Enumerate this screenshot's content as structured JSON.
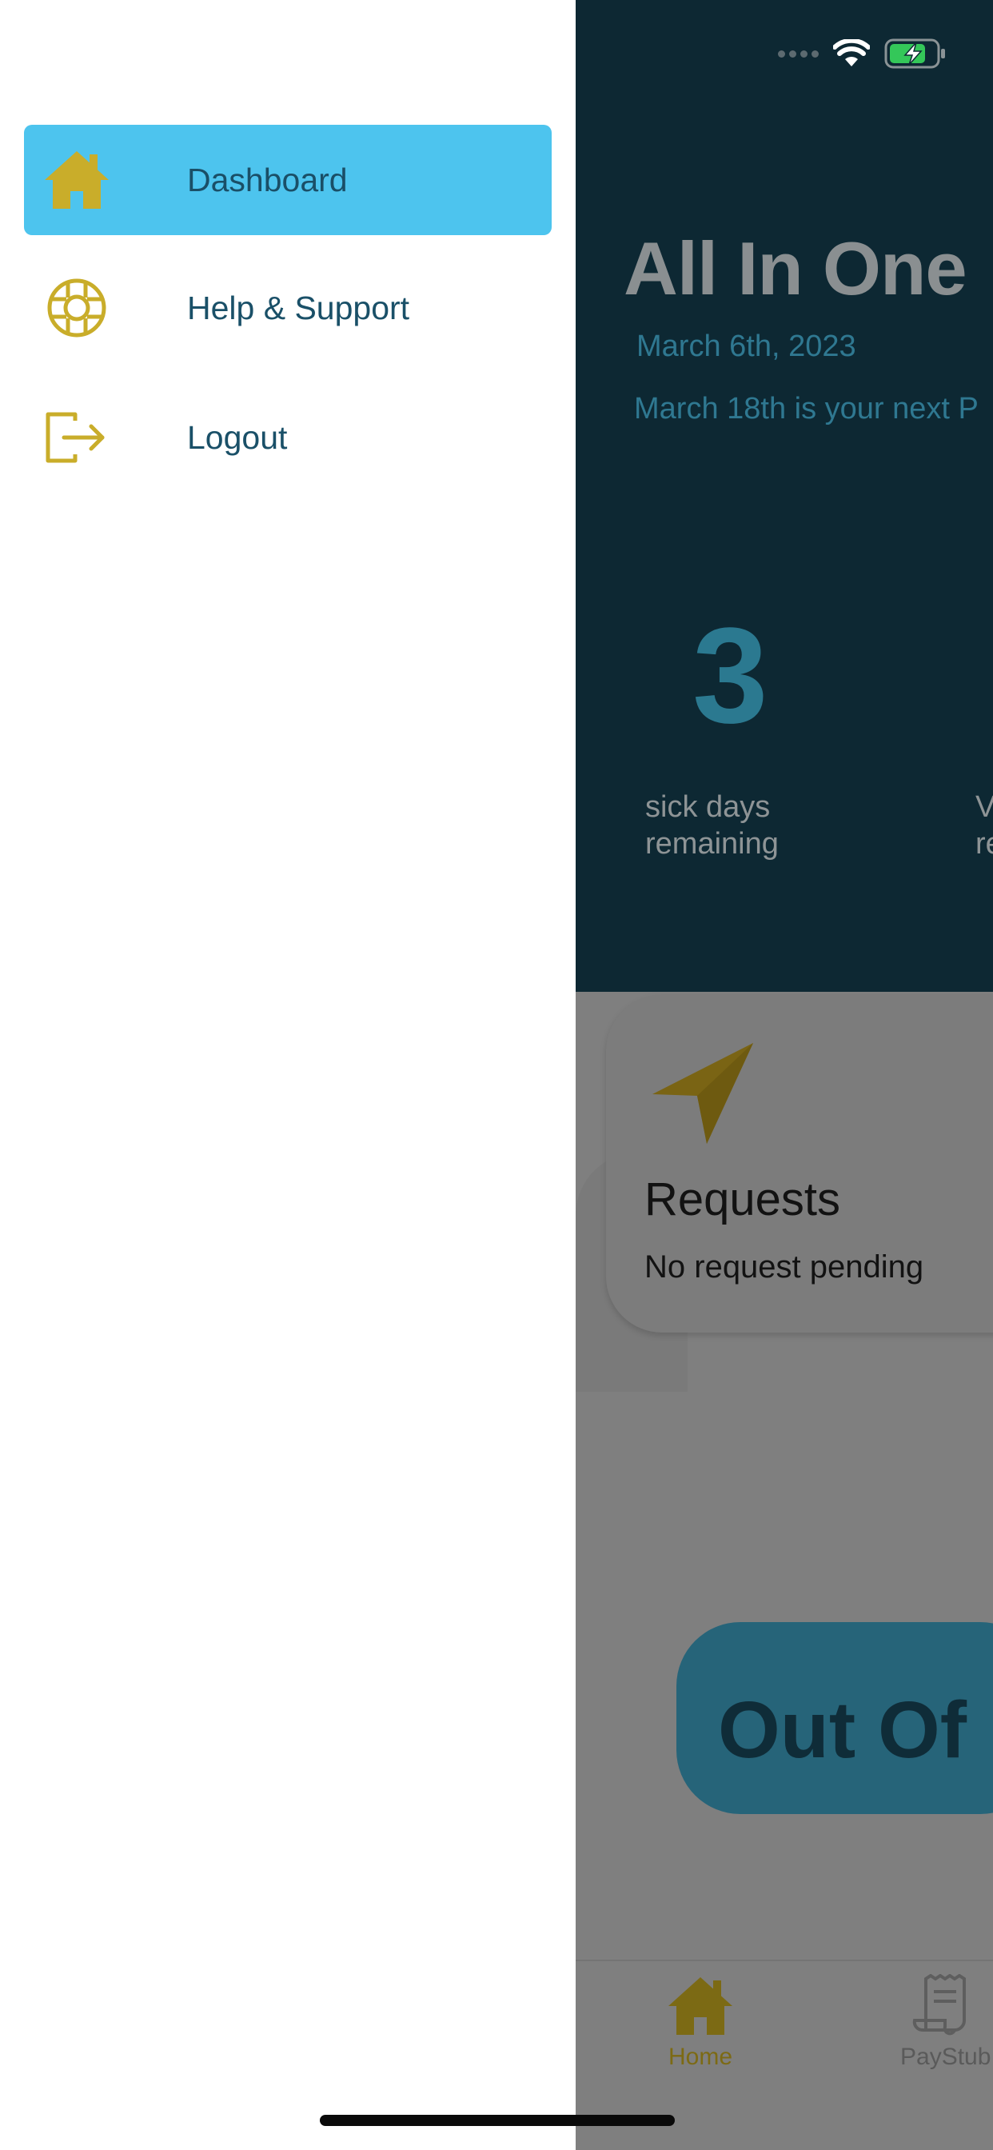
{
  "drawer": {
    "items": [
      {
        "label": "Dashboard",
        "icon": "house-icon",
        "active": true
      },
      {
        "label": "Help & Support",
        "icon": "lifebuoy-icon",
        "active": false
      },
      {
        "label": "Logout",
        "icon": "logout-icon",
        "active": false
      }
    ]
  },
  "background": {
    "title": "All In One",
    "date": "March 6th, 2023",
    "next_payday": "March 18th is your next P",
    "sick_days_value": "3",
    "sick_days_label": "sick days remaining",
    "second_stat_label": "V\nre",
    "requests": {
      "title": "Requests",
      "subtitle": "No request pending"
    },
    "out_of_office": "Out Of",
    "bottom_nav": {
      "home": "Home",
      "paystub": "PayStub"
    }
  },
  "colors": {
    "accent": "#4dc4ee",
    "icon_gold": "#c9ad2a",
    "text_teal": "#1a5068",
    "header_dark": "#0d2833",
    "overlay_gray": "#7f7f7f"
  }
}
